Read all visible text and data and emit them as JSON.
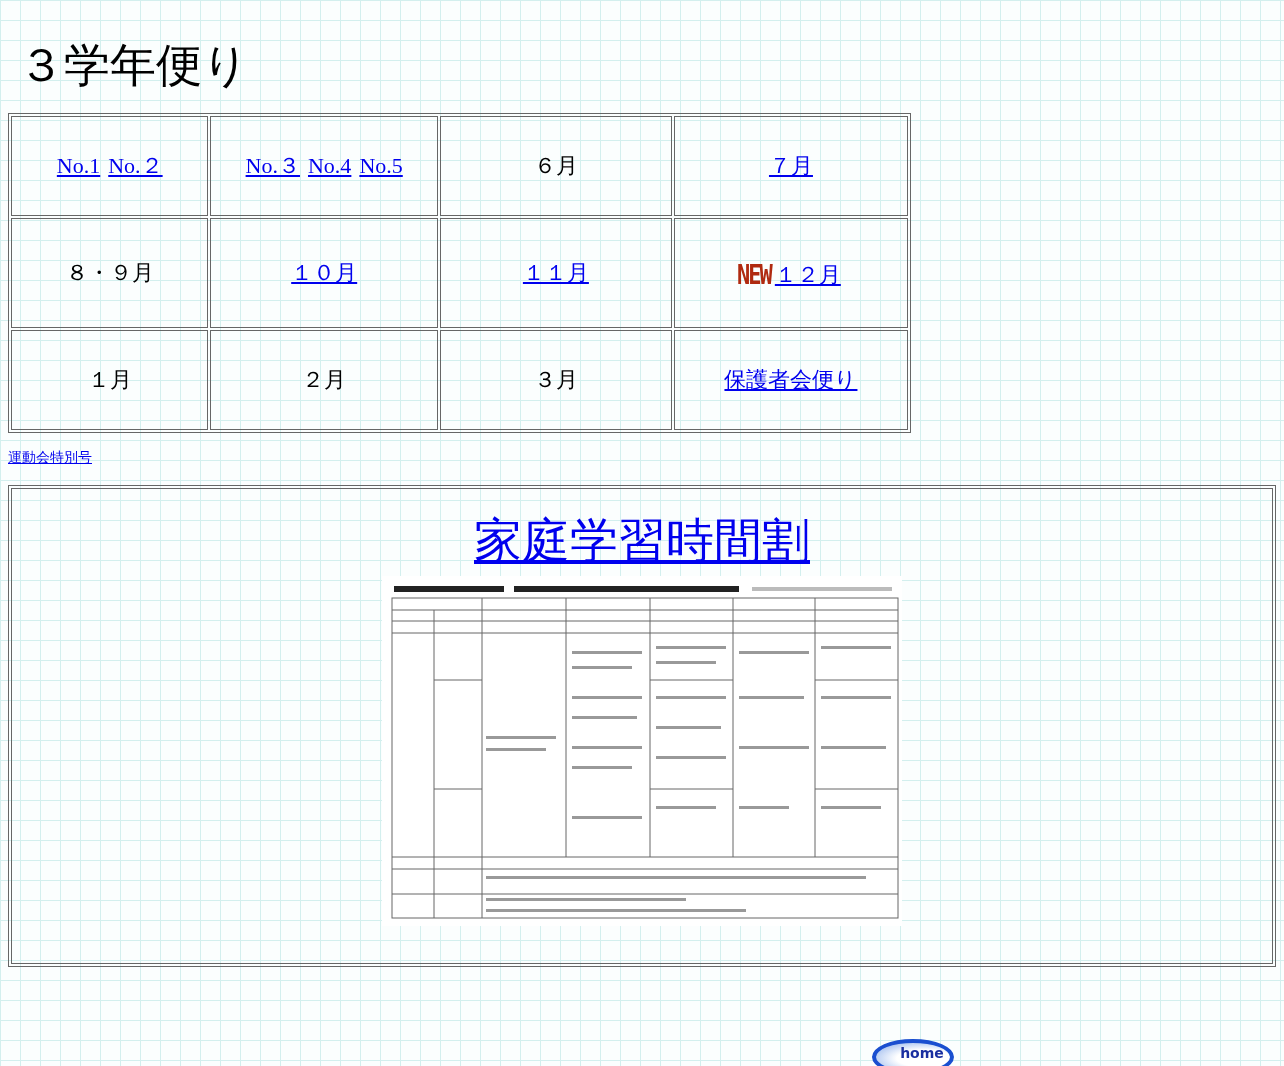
{
  "title": "３学年便り",
  "table": {
    "rows": [
      [
        {
          "items": [
            {
              "kind": "link",
              "text": "No.1"
            },
            {
              "kind": "link",
              "text": "No.２"
            }
          ]
        },
        {
          "items": [
            {
              "kind": "link",
              "text": "No.３"
            },
            {
              "kind": "link",
              "text": "No.4"
            },
            {
              "kind": "link",
              "text": "No.5"
            }
          ]
        },
        {
          "items": [
            {
              "kind": "text",
              "text": "６月"
            }
          ]
        },
        {
          "items": [
            {
              "kind": "link",
              "text": "７月"
            }
          ]
        }
      ],
      [
        {
          "items": [
            {
              "kind": "text",
              "text": "８・９月"
            }
          ]
        },
        {
          "items": [
            {
              "kind": "link",
              "text": "１０月"
            }
          ]
        },
        {
          "items": [
            {
              "kind": "link",
              "text": "１１月"
            }
          ]
        },
        {
          "items": [
            {
              "kind": "badge",
              "text": "NEW"
            },
            {
              "kind": "link",
              "text": "１２月"
            }
          ]
        }
      ],
      [
        {
          "items": [
            {
              "kind": "text",
              "text": "１月"
            }
          ]
        },
        {
          "items": [
            {
              "kind": "text",
              "text": "２月"
            }
          ]
        },
        {
          "items": [
            {
              "kind": "text",
              "text": "３月"
            }
          ]
        },
        {
          "items": [
            {
              "kind": "link",
              "text": "保護者会便り"
            }
          ]
        }
      ]
    ]
  },
  "special_link": "運動会特別号",
  "study": {
    "heading": "家庭学習時間割"
  },
  "home_button": "home"
}
